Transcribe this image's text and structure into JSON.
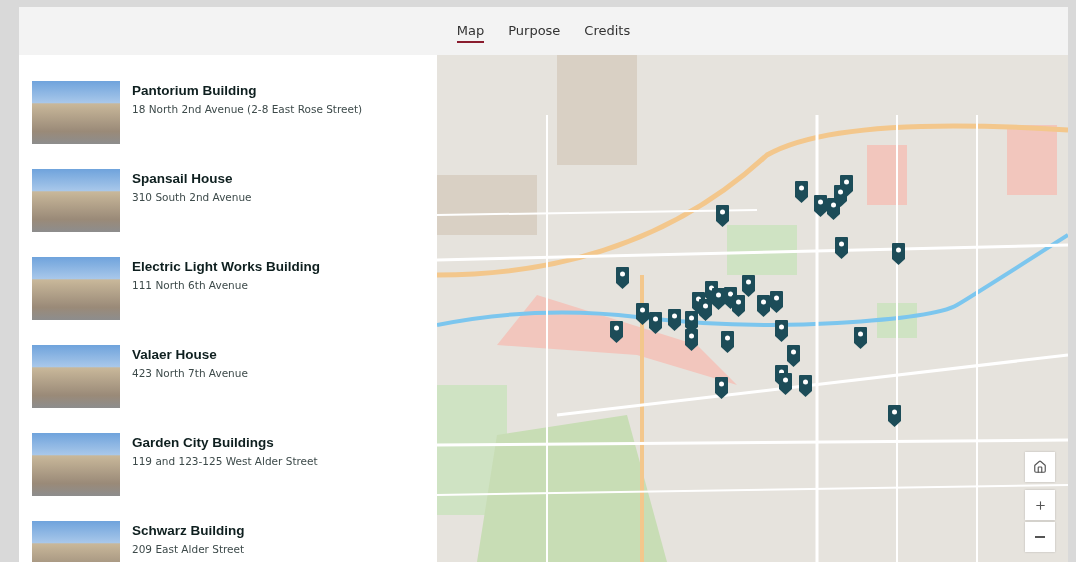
{
  "tabs": [
    {
      "label": "Map",
      "selected": true
    },
    {
      "label": "Purpose",
      "selected": false
    },
    {
      "label": "Credits",
      "selected": false
    }
  ],
  "places": [
    {
      "name": "Pantorium Building",
      "address": "18 North 2nd Avenue (2-8 East Rose Street)"
    },
    {
      "name": "Spansail House",
      "address": "310 South 2nd Avenue"
    },
    {
      "name": "Electric Light Works Building",
      "address": "111 North 6th Avenue"
    },
    {
      "name": "Valaer House",
      "address": "423 North 7th Avenue"
    },
    {
      "name": "Garden City Buildings",
      "address": "119 and 123-125 West Alder Street"
    },
    {
      "name": "Schwarz Building",
      "address": "209 East Alder Street"
    }
  ]
}
